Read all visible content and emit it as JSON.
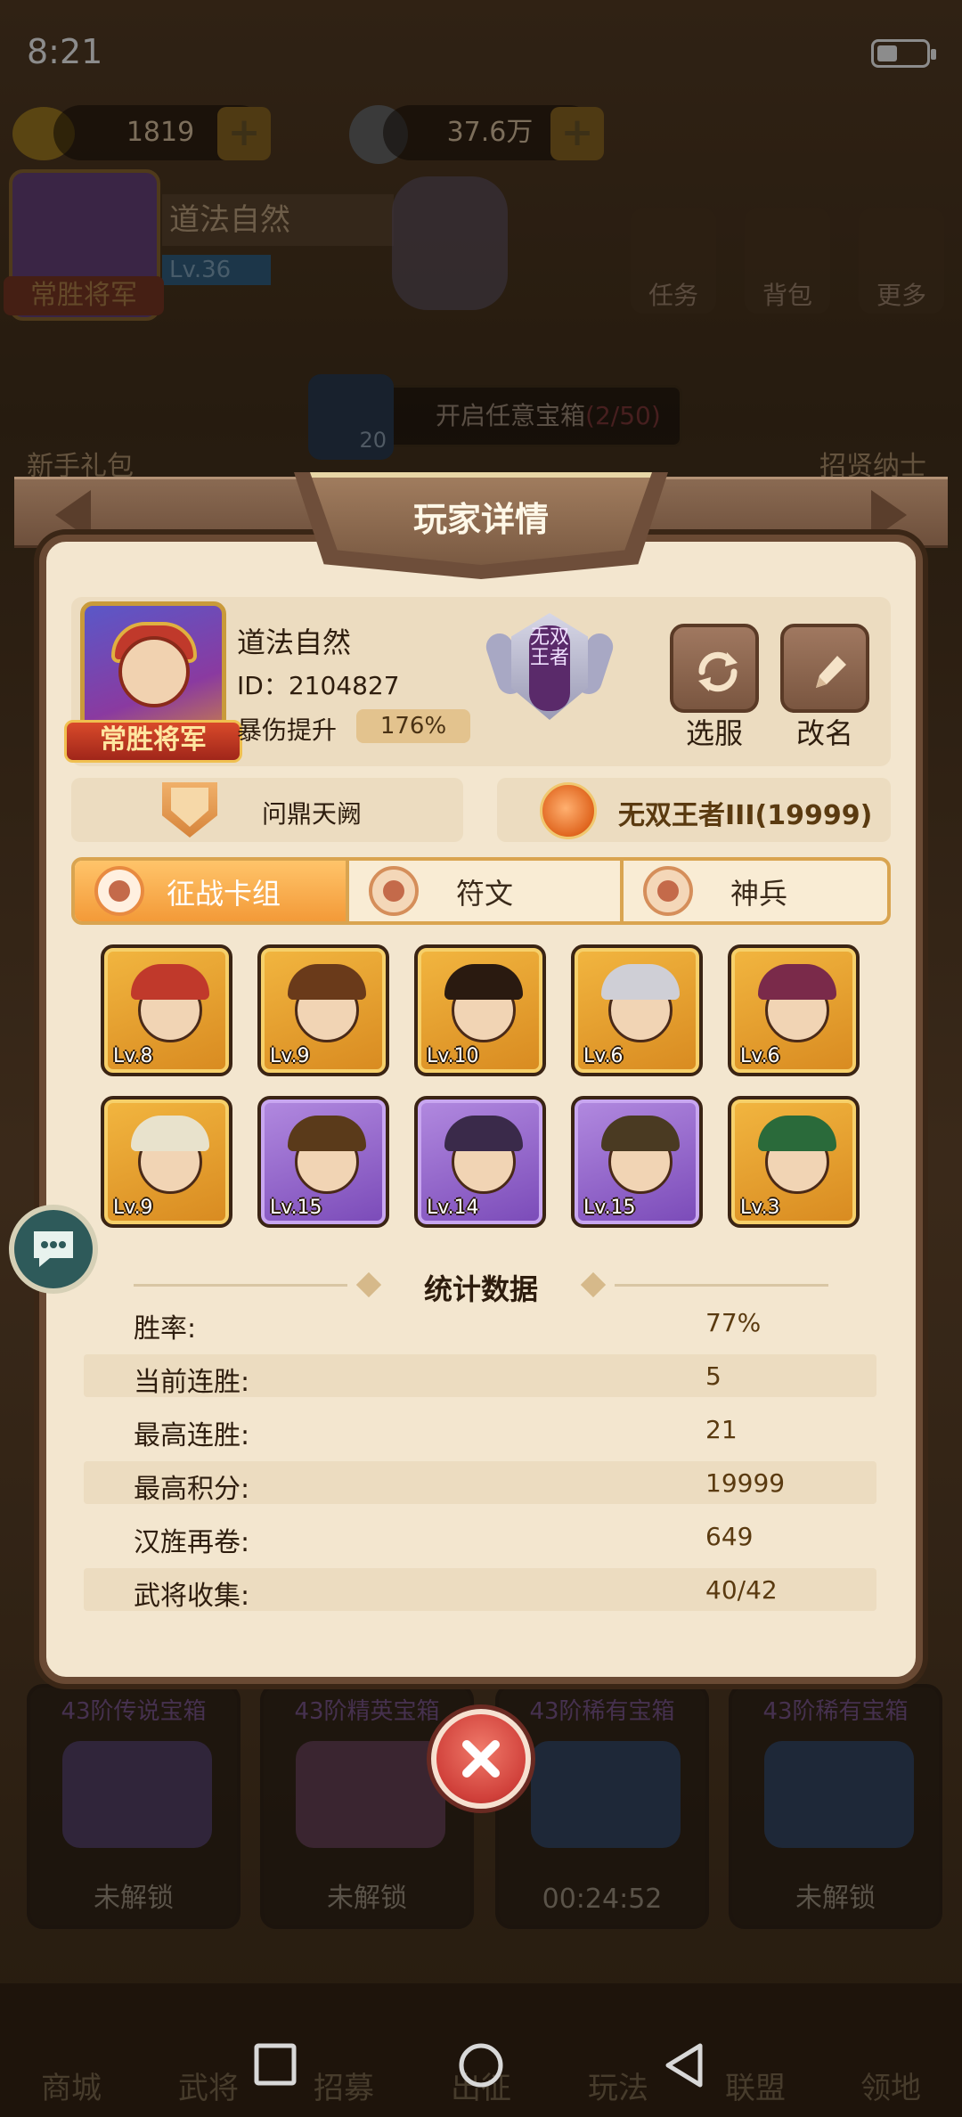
{
  "status_bar": {
    "time": "8:21"
  },
  "background": {
    "resources": {
      "gold": "1819",
      "coins": "37.6万"
    },
    "player": {
      "name": "道法自然",
      "level": "Lv.36",
      "title": "常胜将军"
    },
    "top_buttons": [
      {
        "label": "任务"
      },
      {
        "label": "背包"
      },
      {
        "label": "更多"
      }
    ],
    "side_labels": {
      "newbie_gift": "新手礼包",
      "recruit": "招贤纳士"
    },
    "chest_bar": {
      "count": "20",
      "text": "开启任意宝箱",
      "progress": "(2/50)"
    },
    "chests": [
      {
        "title": "43阶传说宝箱",
        "state": "未解锁"
      },
      {
        "title": "43阶精英宝箱",
        "state": "未解锁"
      },
      {
        "title": "43阶稀有宝箱",
        "state": "00:24:52"
      },
      {
        "title": "43阶稀有宝箱",
        "state": "未解锁"
      }
    ],
    "nav": [
      {
        "label": "商城"
      },
      {
        "label": "武将"
      },
      {
        "label": "招募"
      },
      {
        "label": "出征"
      },
      {
        "label": "玩法"
      },
      {
        "label": "联盟"
      },
      {
        "label": "领地"
      }
    ]
  },
  "dialog": {
    "title": "玩家详情",
    "player": {
      "name": "道法自然",
      "id": "ID：2104827",
      "crit_label": "暴伤提升",
      "crit_value": "176%",
      "title_badge": "常胜将军",
      "rank_emblem_text": "无双王者"
    },
    "actions": {
      "select_server": "选服",
      "rename": "改名"
    },
    "guild": "问鼎天阙",
    "rank": "无双王者III(19999)",
    "tabs": [
      {
        "label": "征战卡组",
        "active": true
      },
      {
        "label": "符文",
        "active": false
      },
      {
        "label": "神兵",
        "active": false
      }
    ],
    "cards": [
      {
        "level": "Lv.8",
        "rarity": "gold",
        "hat": "#c0392b"
      },
      {
        "level": "Lv.9",
        "rarity": "gold",
        "hat": "#6a3a1a"
      },
      {
        "level": "Lv.10",
        "rarity": "gold",
        "hat": "#2a1a10"
      },
      {
        "level": "Lv.6",
        "rarity": "gold",
        "hat": "#cfcfd6"
      },
      {
        "level": "Lv.6",
        "rarity": "gold",
        "hat": "#7a2a4a"
      },
      {
        "level": "Lv.9",
        "rarity": "gold",
        "hat": "#e8e2cc"
      },
      {
        "level": "Lv.15",
        "rarity": "purple",
        "hat": "#5a3a1a"
      },
      {
        "level": "Lv.14",
        "rarity": "purple",
        "hat": "#3a2a4a"
      },
      {
        "level": "Lv.15",
        "rarity": "purple",
        "hat": "#4a3a22"
      },
      {
        "level": "Lv.3",
        "rarity": "gold",
        "hat": "#2a6a3a"
      }
    ],
    "stats_title": "统计数据",
    "stats": [
      {
        "label": "胜率:",
        "value": "77%"
      },
      {
        "label": "当前连胜:",
        "value": "5"
      },
      {
        "label": "最高连胜:",
        "value": "21"
      },
      {
        "label": "最高积分:",
        "value": "19999"
      },
      {
        "label": "汉旌再卷:",
        "value": "649"
      },
      {
        "label": "武将收集:",
        "value": "40/42"
      }
    ]
  }
}
